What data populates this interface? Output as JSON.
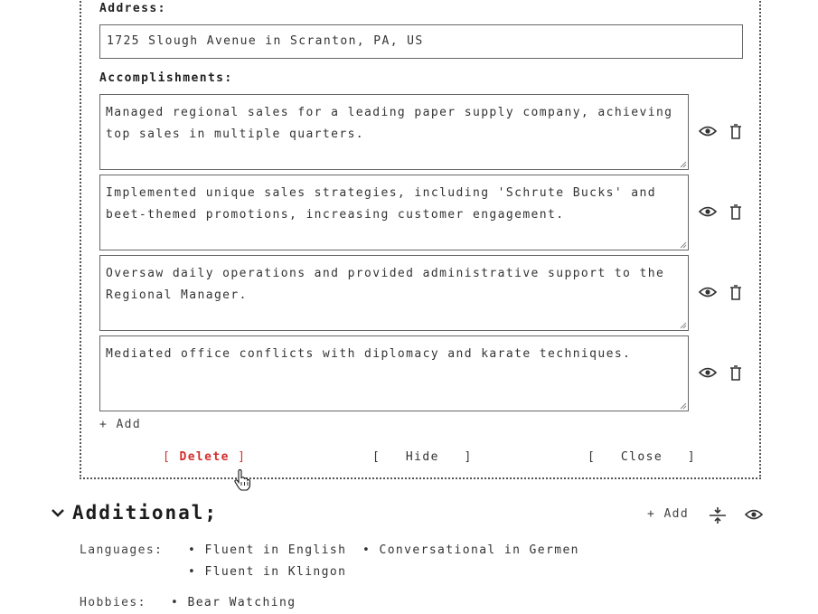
{
  "editor": {
    "address_label": "Address:",
    "address_value": "1725 Slough Avenue in Scranton, PA, US",
    "accomplishments_label": "Accomplishments:",
    "accomplishments": [
      "Managed regional sales for a leading paper supply company, achieving top sales in multiple quarters.",
      "Implemented unique sales strategies, including 'Schrute Bucks' and beet-themed promotions, increasing customer engagement.",
      "Oversaw daily operations and provided administrative support to the Regional Manager.",
      "Mediated office conflicts with diplomacy and karate techniques."
    ],
    "add_label": "+ Add",
    "actions": {
      "delete_open": "[ ",
      "delete_label": "Delete",
      "delete_close": " ]",
      "hide_label": "[   Hide   ]",
      "close_label": "[   Close   ]"
    }
  },
  "additional": {
    "title": "Additional;",
    "add_label": "+ Add",
    "languages_label": "Languages:",
    "languages": [
      "Fluent in English",
      "Conversational in Germen",
      "Fluent in Klingon"
    ],
    "hobbies_label": "Hobbies:",
    "hobbies": [
      "Bear Watching"
    ]
  },
  "colors": {
    "danger": "#d23030",
    "text": "#2b2b2b",
    "border": "#666666"
  },
  "icons": [
    "eye-icon",
    "trash-icon",
    "chevron-down-icon",
    "reorder-icon",
    "hand-cursor-icon"
  ]
}
